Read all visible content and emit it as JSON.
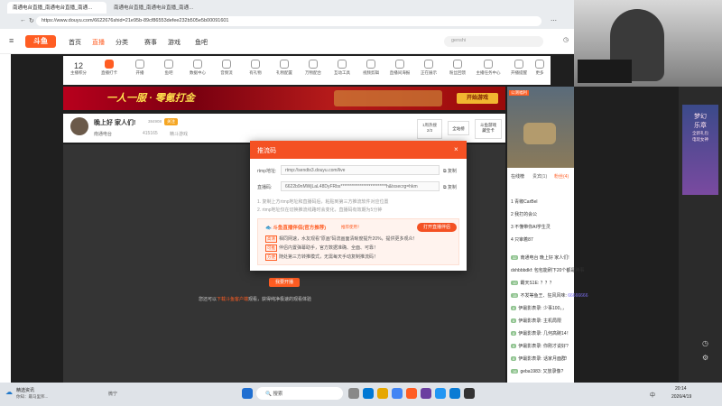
{
  "browser": {
    "tabs": [
      "南通电台直播_南通电台直播_南通…",
      "南通电台直播_南通电台直播_南通…"
    ],
    "url": "https://www.douyu.com/6622676shid=21e95b-89cf86553defee232b505e5b00091601"
  },
  "site": {
    "logo": "斗鱼",
    "nav": [
      "首页",
      "直播",
      "分类",
      "赛事",
      "游戏",
      "鱼吧"
    ],
    "search_placeholder": "genshi"
  },
  "iconbar": {
    "items": [
      {
        "label": "主播积分",
        "value": "12",
        "icon": "score-icon"
      },
      {
        "label": "直播打卡",
        "icon": "checkin-icon"
      },
      {
        "label": "开播",
        "icon": "start-icon"
      },
      {
        "label": "鱼吧",
        "icon": "fishbar-icon"
      },
      {
        "label": "数据中心",
        "icon": "data-icon"
      },
      {
        "label": "音频流",
        "icon": "audio-icon"
      },
      {
        "label": "有礼物",
        "icon": "gift-icon"
      },
      {
        "label": "礼物配置",
        "icon": "gift-config-icon"
      },
      {
        "label": "万物配合",
        "icon": "tools-icon"
      },
      {
        "label": "互动工具",
        "icon": "interact-icon"
      },
      {
        "label": "视频剪辑",
        "icon": "video-icon"
      },
      {
        "label": "直播间海报",
        "icon": "poster-icon"
      },
      {
        "label": "正在展示",
        "icon": "showcase-icon"
      },
      {
        "label": "粉丝回馈",
        "icon": "fans-icon"
      },
      {
        "label": "主播任务中心",
        "icon": "task-icon"
      },
      {
        "label": "开播提醒",
        "icon": "reminder-icon"
      },
      {
        "label": "更多",
        "icon": "more-icon"
      }
    ]
  },
  "banner": {
    "slogan": "一人一服 · 零氪打金",
    "button": "开始游戏"
  },
  "room": {
    "title": "晚上好 家人们!",
    "room_id": "384908",
    "follow": "关注",
    "streamer": "南通电台",
    "viewers": "415165",
    "category": "精斗游戏",
    "rank_label": "1周热搜",
    "rank_value": "2/3",
    "all_button": "全站榜",
    "gift_label": "斗鱼游戏",
    "gift_sub": "藏宝卡"
  },
  "modal": {
    "title": "推流码",
    "rtmp_label": "rtmp地址:",
    "rtmp_value": "rtmp://sendtx3.douyu.com/live",
    "stream_label": "直播码:",
    "stream_value": "6622b9nMWjLaL48DyFRbs**************************h&txsecrg=hkm",
    "copy": "复制",
    "note1": "1. 复制上方rtmp地址和直播码后，粘贴到第三方推流软件对应位置",
    "note2": "2. rtmp地址仅在切换推流线路时会变化，直播码有效期为5分钟",
    "promo_title": "斗鱼直播伴侣(官方推荐)",
    "promo_badge": "推荐使用！",
    "promo_button": "打开直播伴侣",
    "promo_lines": [
      {
        "tag": "高清",
        "text": "相同网速，水友观看\"原画\"码流画面清晰度提升20%，提供更多观众！"
      },
      {
        "tag": "可推",
        "text": "伴侣内置弹幕助手，官方数据准确、全面、可靠！"
      },
      {
        "tag": "方便",
        "text": "随处第三方转推模式，无需每天手动复制推流码！"
      }
    ]
  },
  "player": {
    "start_button": "我要开播",
    "hint_prefix": "您还可以",
    "hint_link": "下载斗鱼客户端",
    "hint_suffix": "观看，获得纯净极速的观看体验"
  },
  "rightpanel": {
    "badge": "公测福利",
    "tabs": [
      "在线榜",
      "贵宾(1)",
      "粉丝(4)"
    ],
    "ranks": [
      {
        "rank": "1",
        "name": "青椒CarBel",
        "tag": "钻粉"
      },
      {
        "rank": "2",
        "name": "我打的会公",
        "tag": "钻粉"
      },
      {
        "rank": "3",
        "name": "不懂带你AI学生灵",
        "tag": "钻粉"
      },
      {
        "rank": "4",
        "name": "只审着87",
        "tag": "钻粉"
      }
    ],
    "chat": [
      {
        "user": "南通电台",
        "text": "晚上好 家人们!"
      },
      {
        "user": "dxhbbbdkf:",
        "text": "包包能刷下20个都是腾事"
      },
      {
        "user": "霸天S1E:",
        "text": "？？？"
      },
      {
        "user": "",
        "text": "不发等鱼王、狂风风味:",
        "extra": "66666666"
      },
      {
        "user": "伊最影表录:",
        "text": "少事100，，"
      },
      {
        "user": "伊最影表录:",
        "text": "主机局限"
      },
      {
        "user": "伊最影表录:",
        "text": "几何高碗14！"
      },
      {
        "user": "伊最影表录:",
        "text": "你刚才说好?"
      },
      {
        "user": "伊最影表录:",
        "text": "话家月面群!"
      },
      {
        "user": "geba1983:",
        "text": "又放录像?"
      }
    ]
  },
  "webcam": {
    "ad_lines": [
      "梦幻",
      "乐章",
      "全新礼包",
      "电玩女神"
    ]
  },
  "taskbar": {
    "weather_title": "精选资讯",
    "weather_sub": "你知：最马里邦...",
    "search_hint": "微宁",
    "search": "搜索",
    "time": "20:14",
    "date": "2026/4/19",
    "lang": "中"
  },
  "colors": {
    "brand": "#ff5d23",
    "modal_header": "#f45123"
  }
}
